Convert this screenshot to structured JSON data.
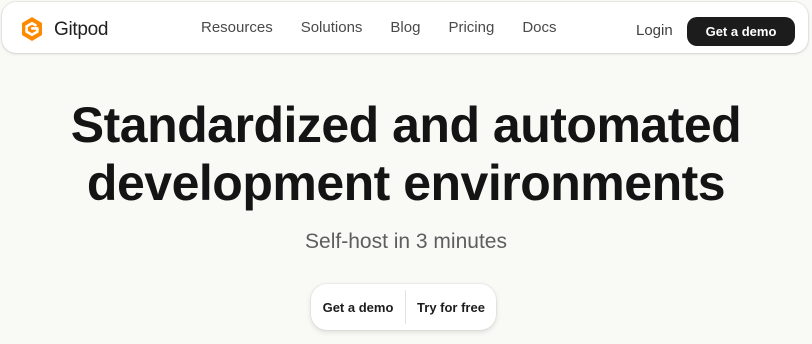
{
  "brand": {
    "name": "Gitpod",
    "logo_icon": "gitpod-logo-icon",
    "logo_color": "#ff8a00"
  },
  "nav": {
    "links": [
      "Resources",
      "Solutions",
      "Blog",
      "Pricing",
      "Docs"
    ],
    "login": "Login",
    "demo_button": "Get a demo"
  },
  "hero": {
    "title_line1": "Standardized and automated",
    "title_line2": "development environments",
    "subtitle": "Self-host in 3 minutes",
    "cta_demo": "Get a demo",
    "cta_try": "Try for free"
  },
  "colors": {
    "page_background": "#f9f9f6",
    "dark_button": "#1c1c1c",
    "text_dark": "#141414"
  }
}
